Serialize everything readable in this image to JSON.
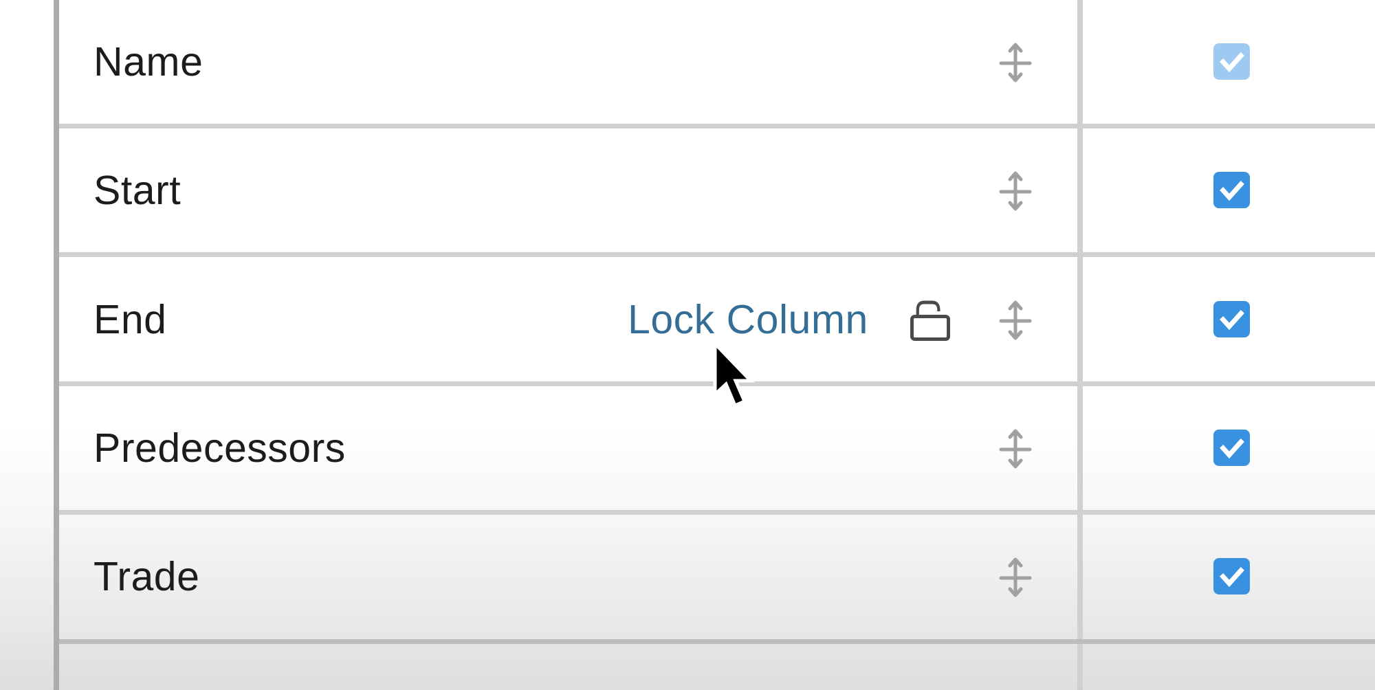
{
  "columns_list": {
    "rows": [
      {
        "label": "Name",
        "visible": true,
        "visibility_locked": true
      },
      {
        "label": "Start",
        "visible": true,
        "visibility_locked": false
      },
      {
        "label": "End",
        "visible": true,
        "visibility_locked": false,
        "hovered": true
      },
      {
        "label": "Predecessors",
        "visible": true,
        "visibility_locked": false
      },
      {
        "label": "Trade",
        "visible": true,
        "visibility_locked": false
      },
      {
        "label": "",
        "visible": null,
        "visibility_locked": null
      }
    ],
    "hover_action": {
      "label": "Lock Column",
      "icon": "unlock-icon",
      "row_index": 2
    },
    "row_icons": {
      "drag": "drag-handle-icon",
      "checkbox": "checkmark-icon"
    }
  },
  "colors": {
    "checkbox_checked": "#3892e0",
    "checkbox_disabled": "#9ecaf1",
    "link": "#346e97",
    "text": "#1c1c1e",
    "icon_gray": "#a0a0a0",
    "lock_icon": "#4a4a4a",
    "divider": "#d0d0d0"
  }
}
